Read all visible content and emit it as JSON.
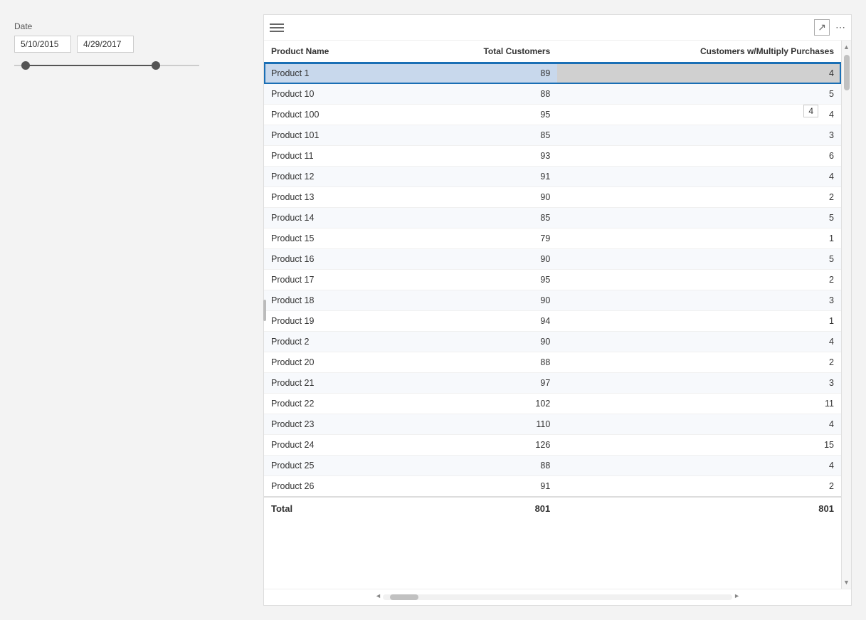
{
  "date_filter": {
    "label": "Date",
    "start_date": "5/10/2015",
    "end_date": "4/29/2017"
  },
  "table": {
    "columns": {
      "product_name": "Product Name",
      "total_customers": "Total Customers",
      "customers_w_multiply": "Customers w/Multiply Purchases"
    },
    "rows": [
      {
        "name": "Product 1",
        "total": 89,
        "multiply": 4,
        "selected": true
      },
      {
        "name": "Product 10",
        "total": 88,
        "multiply": 5,
        "selected": false
      },
      {
        "name": "Product 100",
        "total": 95,
        "multiply": 4,
        "selected": false
      },
      {
        "name": "Product 101",
        "total": 85,
        "multiply": 3,
        "selected": false
      },
      {
        "name": "Product 11",
        "total": 93,
        "multiply": 6,
        "selected": false
      },
      {
        "name": "Product 12",
        "total": 91,
        "multiply": 4,
        "selected": false
      },
      {
        "name": "Product 13",
        "total": 90,
        "multiply": 2,
        "selected": false
      },
      {
        "name": "Product 14",
        "total": 85,
        "multiply": 5,
        "selected": false
      },
      {
        "name": "Product 15",
        "total": 79,
        "multiply": 1,
        "selected": false
      },
      {
        "name": "Product 16",
        "total": 90,
        "multiply": 5,
        "selected": false
      },
      {
        "name": "Product 17",
        "total": 95,
        "multiply": 2,
        "selected": false
      },
      {
        "name": "Product 18",
        "total": 90,
        "multiply": 3,
        "selected": false
      },
      {
        "name": "Product 19",
        "total": 94,
        "multiply": 1,
        "selected": false
      },
      {
        "name": "Product 2",
        "total": 90,
        "multiply": 4,
        "selected": false
      },
      {
        "name": "Product 20",
        "total": 88,
        "multiply": 2,
        "selected": false
      },
      {
        "name": "Product 21",
        "total": 97,
        "multiply": 3,
        "selected": false
      },
      {
        "name": "Product 22",
        "total": 102,
        "multiply": 11,
        "selected": false
      },
      {
        "name": "Product 23",
        "total": 110,
        "multiply": 4,
        "selected": false
      },
      {
        "name": "Product 24",
        "total": 126,
        "multiply": 15,
        "selected": false
      },
      {
        "name": "Product 25",
        "total": 88,
        "multiply": 4,
        "selected": false
      },
      {
        "name": "Product 26",
        "total": 91,
        "multiply": 2,
        "selected": false
      }
    ],
    "footer": {
      "label": "Total",
      "total_customers": 801,
      "customers_w_multiply": 801
    }
  }
}
